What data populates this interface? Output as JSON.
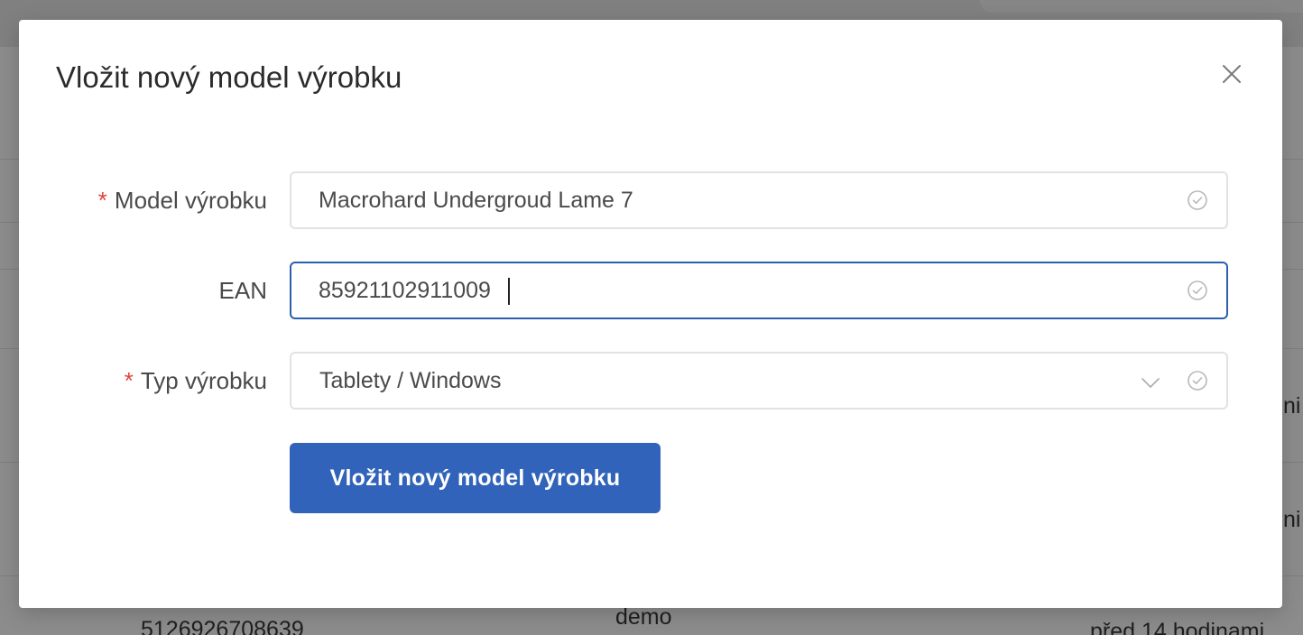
{
  "background": {
    "row_code": "5126926708639",
    "row_user": "demo",
    "row_time": "před 14 hodinami",
    "row_fragment_1": "ni",
    "row_fragment_2": "ni"
  },
  "modal": {
    "title": "Vložit nový model výrobku",
    "close_icon": "close-icon",
    "fields": {
      "model": {
        "label": "Model výrobku",
        "required": "*",
        "value": "Macrohard Undergroud Lame 7"
      },
      "ean": {
        "label": "EAN",
        "value": "85921102911009"
      },
      "type": {
        "label": "Typ výrobku",
        "required": "*",
        "value": "Tablety / Windows"
      }
    },
    "submit_label": "Vložit nový model výrobku",
    "colors": {
      "primary": "#3063b9",
      "focus_border": "#2c5fad",
      "required": "#e0453c"
    }
  }
}
